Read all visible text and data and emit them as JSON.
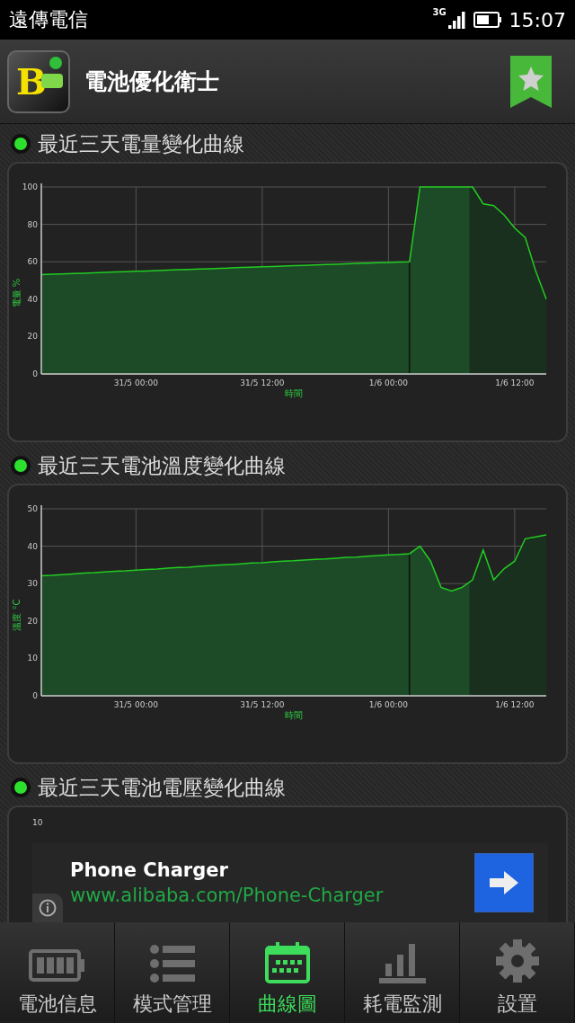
{
  "status_bar": {
    "carrier": "遠傳電信",
    "network": "3G",
    "time": "15:07"
  },
  "app_bar": {
    "logo_letter": "B",
    "title": "電池優化衛士"
  },
  "sections": [
    {
      "title": "最近三天電量變化曲線",
      "chart_data": {
        "type": "area",
        "xlabel": "時間",
        "ylabel": "電量 %",
        "ylim": [
          0,
          100
        ],
        "yticks": [
          0,
          20,
          40,
          60,
          80,
          100
        ],
        "categories": [
          null,
          null,
          null,
          null,
          null,
          null,
          null,
          null,
          null,
          "31/5 00:00",
          null,
          null,
          null,
          null,
          null,
          null,
          null,
          null,
          null,
          null,
          null,
          "31/5 12:00",
          null,
          null,
          null,
          null,
          null,
          null,
          null,
          null,
          null,
          null,
          null,
          "1/6 00:00",
          null,
          null,
          null,
          null,
          null,
          null,
          null,
          null,
          null,
          null,
          null,
          "1/6 12:00",
          null,
          null,
          null
        ],
        "grid": true,
        "series": [
          {
            "color": "#22cc22",
            "values": [
              53.1,
              53.3,
              53.5,
              53.7,
              53.9,
              54.1,
              54.3,
              54.5,
              54.7,
              54.9,
              55.1,
              55.3,
              55.5,
              55.7,
              55.9,
              56.1,
              56.3,
              56.5,
              56.7,
              56.9,
              57.1,
              57.3,
              57.5,
              57.7,
              57.9,
              58.1,
              58.3,
              58.5,
              58.7,
              58.9,
              59.1,
              59.3,
              59.5,
              59.6,
              59.8,
              60,
              100,
              100,
              100,
              100,
              100,
              100,
              91,
              90,
              85,
              78,
              73,
              55,
              40
            ]
          }
        ]
      }
    },
    {
      "title": "最近三天電池溫度變化曲線",
      "chart_data": {
        "type": "area",
        "xlabel": "時間",
        "ylabel": "溫度 °C",
        "ylim": [
          0,
          50
        ],
        "yticks": [
          0,
          10,
          20,
          30,
          40,
          50
        ],
        "categories": [
          null,
          null,
          null,
          null,
          null,
          null,
          null,
          null,
          null,
          "31/5 00:00",
          null,
          null,
          null,
          null,
          null,
          null,
          null,
          null,
          null,
          null,
          null,
          "31/5 12:00",
          null,
          null,
          null,
          null,
          null,
          null,
          null,
          null,
          null,
          null,
          null,
          "1/6 00:00",
          null,
          null,
          null,
          null,
          null,
          null,
          null,
          null,
          null,
          null,
          null,
          "1/6 12:00",
          null,
          null,
          null
        ],
        "grid": true,
        "series": [
          {
            "color": "#22cc22",
            "values": [
              32.1,
              32.2,
              32.4,
              32.6,
              32.8,
              32.9,
              33.1,
              33.3,
              33.4,
              33.6,
              33.8,
              33.9,
              34.1,
              34.3,
              34.4,
              34.6,
              34.8,
              35.0,
              35.1,
              35.3,
              35.5,
              35.6,
              35.8,
              36.0,
              36.1,
              36.3,
              36.5,
              36.6,
              36.8,
              37.0,
              37.1,
              37.3,
              37.5,
              37.7,
              37.8,
              38.0,
              40,
              36,
              29,
              28,
              29,
              31,
              39,
              31,
              34,
              36,
              42,
              42.5,
              43
            ]
          }
        ]
      }
    },
    {
      "title": "最近三天電池電壓變化曲線",
      "top_tick": "10"
    }
  ],
  "ad": {
    "title": "Phone Charger",
    "url": "www.alibaba.com/Phone-Charger"
  },
  "nav": [
    {
      "kind": "battery",
      "label": "電池信息",
      "selected": false
    },
    {
      "kind": "list",
      "label": "模式管理",
      "selected": false
    },
    {
      "kind": "calendar",
      "label": "曲線圖",
      "selected": true
    },
    {
      "kind": "bars",
      "label": "耗電監測",
      "selected": false
    },
    {
      "kind": "gear",
      "label": "設置",
      "selected": false
    }
  ]
}
